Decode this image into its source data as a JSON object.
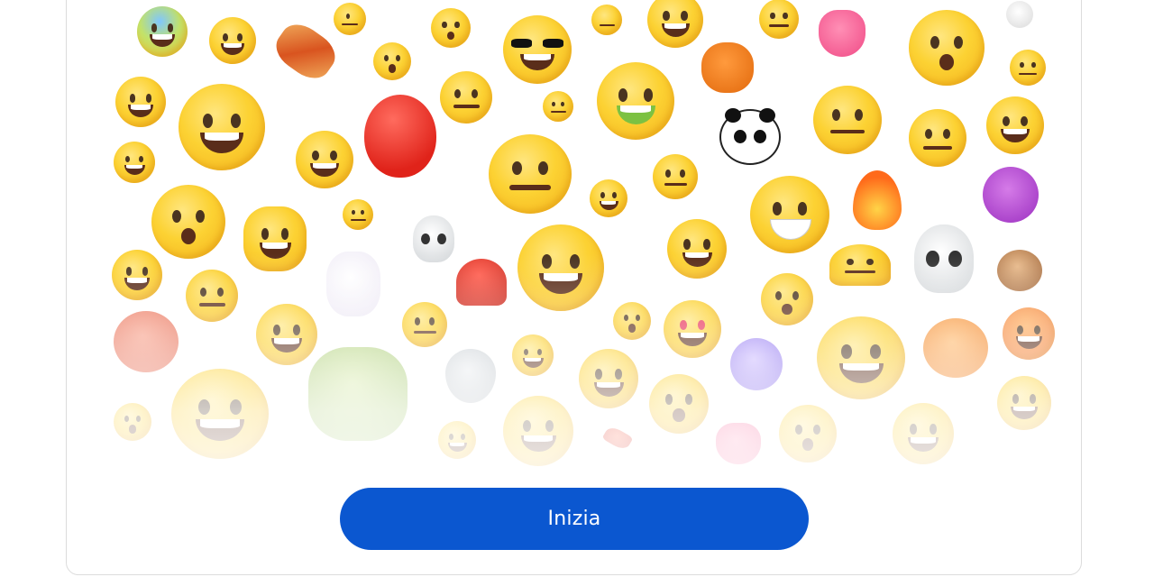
{
  "start_button": {
    "label": "Inizia"
  },
  "colors": {
    "accent": "#0b57d0",
    "button_text": "#ffffff",
    "card_border": "#dcdcdc"
  },
  "emoji_grid": {
    "icons": [
      "smiling-face-icon",
      "balloon-icon",
      "pumpkin-icon",
      "panda-icon",
      "smiling-face-with-horns-icon",
      "skull-icon",
      "heart-icon",
      "fire-icon",
      "monkey-icon",
      "octopus-icon",
      "alien-icon",
      "mushroom-icon",
      "crystal-ball-icon",
      "bouquet-icon",
      "hot-dog-icon",
      "unicorn-icon",
      "hot-pepper-icon",
      "hot-beverage-icon"
    ]
  }
}
